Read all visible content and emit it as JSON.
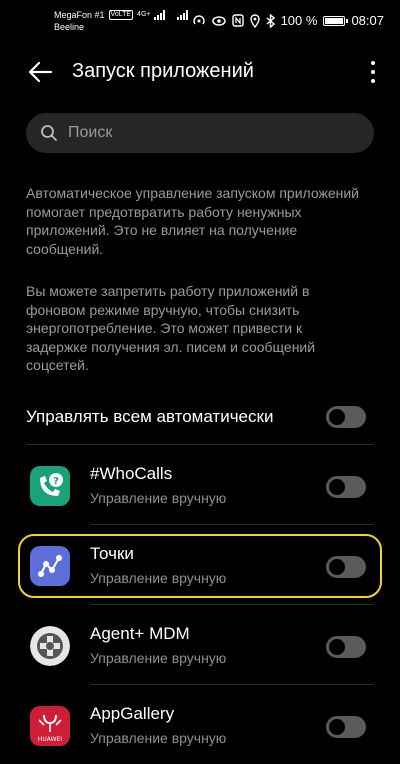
{
  "status_bar": {
    "carrier1": "MegaFon #1",
    "volte": "VoLTE",
    "net_type": "4G+",
    "carrier2": "Beeline",
    "battery": "100 %",
    "battery_level": 1.0,
    "time": "08:07"
  },
  "header": {
    "title": "Запуск приложений"
  },
  "search": {
    "placeholder": "Поиск",
    "value": ""
  },
  "descriptions": [
    "Автоматическое управление запуском приложений помогает предотвратить работу ненужных приложений. Это не влияет на получение сообщений.",
    "Вы можете запретить работу приложений в фоновом режиме вручную, чтобы снизить энергопотребление. Это может привести к задержке получения эл. писем и сообщений соцсетей."
  ],
  "master_toggle": {
    "label": "Управлять всем автоматически",
    "on": false
  },
  "apps": [
    {
      "name": "#WhoCalls",
      "status": "Управление вручную",
      "icon": "whocalls-icon",
      "on": false
    },
    {
      "name": "Точки",
      "status": "Управление вручную",
      "icon": "tochki-icon",
      "on": false,
      "highlighted": true
    },
    {
      "name": "Agent+ MDM",
      "status": "Управление вручную",
      "icon": "agent-mdm-icon",
      "on": false
    },
    {
      "name": "AppGallery",
      "status": "Управление вручную",
      "icon": "appgallery-icon",
      "on": false,
      "icon_text": "HUAWEI"
    }
  ],
  "colors": {
    "background": "#000000",
    "highlight": "#f4d22c",
    "whocalls": "#1aa37a",
    "tochki": "#5d6fd8",
    "appgallery": "#cf1f38"
  }
}
